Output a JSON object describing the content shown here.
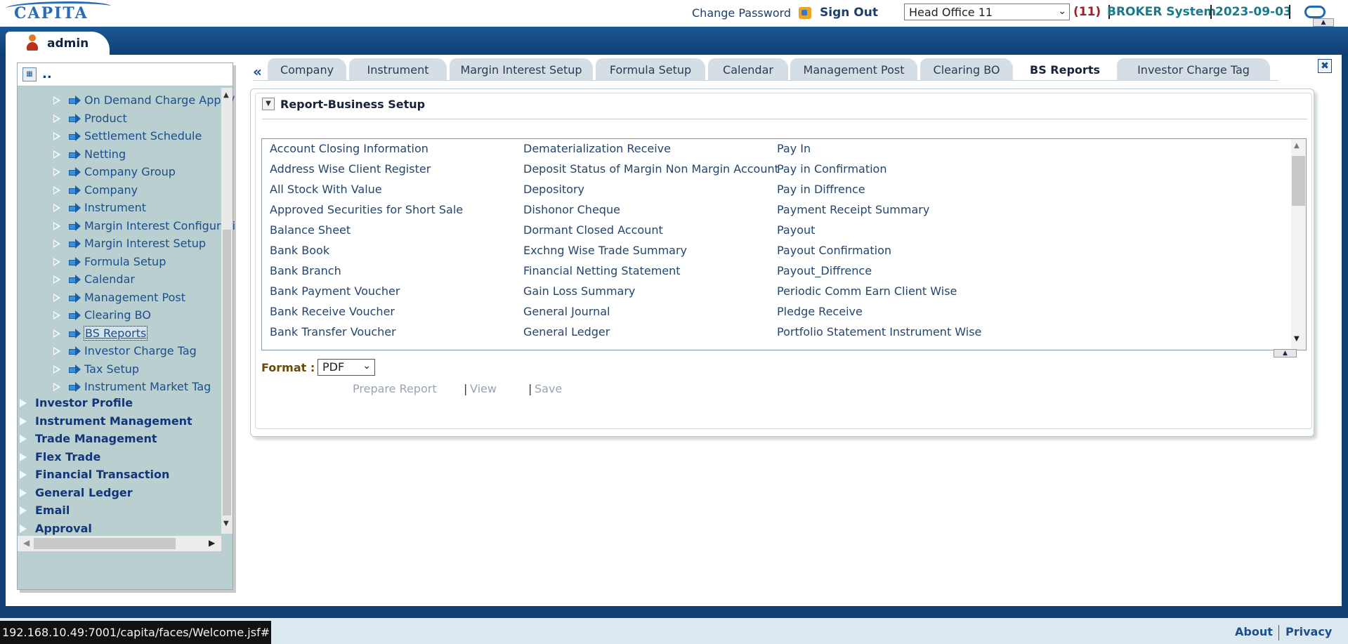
{
  "header": {
    "logo_text": "CAPITA",
    "change_password": "Change Password",
    "sign_out": "Sign Out",
    "branch_value": "Head Office 11",
    "count": "(11)",
    "system_name": "BROKER System",
    "date": "2023-09-03"
  },
  "user": {
    "name": "admin"
  },
  "tree": {
    "head_label": "..",
    "items": [
      {
        "label": "On Demand Charge Apply/"
      },
      {
        "label": "Product"
      },
      {
        "label": "Settlement Schedule"
      },
      {
        "label": "Netting"
      },
      {
        "label": "Company Group"
      },
      {
        "label": "Company"
      },
      {
        "label": "Instrument"
      },
      {
        "label": "Margin Interest Configurati"
      },
      {
        "label": "Margin Interest Setup"
      },
      {
        "label": "Formula Setup"
      },
      {
        "label": "Calendar"
      },
      {
        "label": "Management Post"
      },
      {
        "label": "Clearing BO"
      },
      {
        "label": "BS Reports"
      },
      {
        "label": "Investor Charge Tag"
      },
      {
        "label": "Tax Setup"
      },
      {
        "label": "Instrument Market Tag"
      }
    ],
    "selected": "BS Reports",
    "categories": [
      {
        "label": "Investor Profile"
      },
      {
        "label": "Instrument Management"
      },
      {
        "label": "Trade Management"
      },
      {
        "label": "Flex Trade"
      },
      {
        "label": "Financial Transaction"
      },
      {
        "label": "General Ledger"
      },
      {
        "label": "Email"
      },
      {
        "label": "Approval"
      }
    ]
  },
  "tabs": [
    {
      "label": "Company"
    },
    {
      "label": "Instrument"
    },
    {
      "label": "Margin Interest Setup"
    },
    {
      "label": "Formula Setup"
    },
    {
      "label": "Calendar"
    },
    {
      "label": "Management Post"
    },
    {
      "label": "Clearing BO"
    },
    {
      "label": "BS Reports"
    },
    {
      "label": "Investor Charge Tag"
    }
  ],
  "active_tab": "BS Reports",
  "report": {
    "section_title": "Report-Business Setup",
    "columns": [
      [
        "Account Closing Information",
        "Address Wise Client Register",
        "All Stock With Value",
        "Approved Securities for Short Sale",
        "Balance Sheet",
        "Bank Book",
        "Bank Branch",
        "Bank Payment Voucher",
        "Bank Receive Voucher",
        "Bank Transfer Voucher"
      ],
      [
        "Dematerialization Receive",
        "Deposit Status of Margin Non Margin Account",
        "Depository",
        "Dishonor Cheque",
        "Dormant Closed Account",
        "Exchng Wise Trade Summary",
        "Financial Netting Statement",
        "Gain Loss Summary",
        "General Journal",
        "General Ledger"
      ],
      [
        "Pay In",
        "Pay in Confirmation",
        "Pay in Diffrence",
        "Payment Receipt Summary",
        "Payout",
        "Payout Confirmation",
        "Payout_Diffrence",
        "Periodic Comm Earn Client Wise",
        "Pledge Receive",
        "Portfolio Statement Instrument Wise"
      ]
    ],
    "format_label": "Format :",
    "format_value": "PDF",
    "prepare_label": "Prepare Report",
    "view_label": "View",
    "save_label": "Save"
  },
  "footer": {
    "url": "192.168.10.49:7001/capita/faces/Welcome.jsf#",
    "about": "About",
    "privacy": "Privacy"
  },
  "colors": {
    "header_band": "#0f3f73",
    "tree_bg": "#b9cfd0",
    "system_text": "#1b7a8a",
    "count_text": "#a0202a",
    "format_label": "#6a4a08"
  }
}
